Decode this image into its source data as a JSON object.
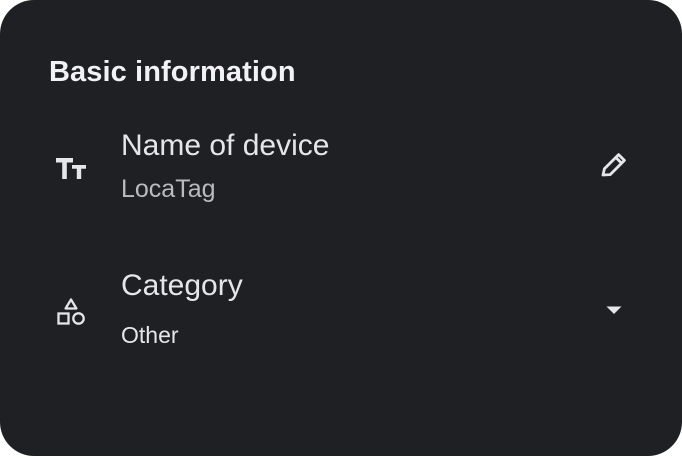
{
  "section": {
    "title": "Basic information"
  },
  "fields": {
    "name": {
      "label": "Name of device",
      "value": "LocaTag",
      "icon": "text-fields-icon",
      "action_icon": "edit-pencil-icon"
    },
    "category": {
      "label": "Category",
      "value": "Other",
      "icon": "shapes-category-icon",
      "action_icon": "dropdown-arrow-icon"
    }
  },
  "colors": {
    "card_background": "#1f2024",
    "title_text": "#f2f2f4",
    "primary_text": "#e6e6e9",
    "secondary_text": "#b9bbc0",
    "icon": "#e6e6e9"
  }
}
